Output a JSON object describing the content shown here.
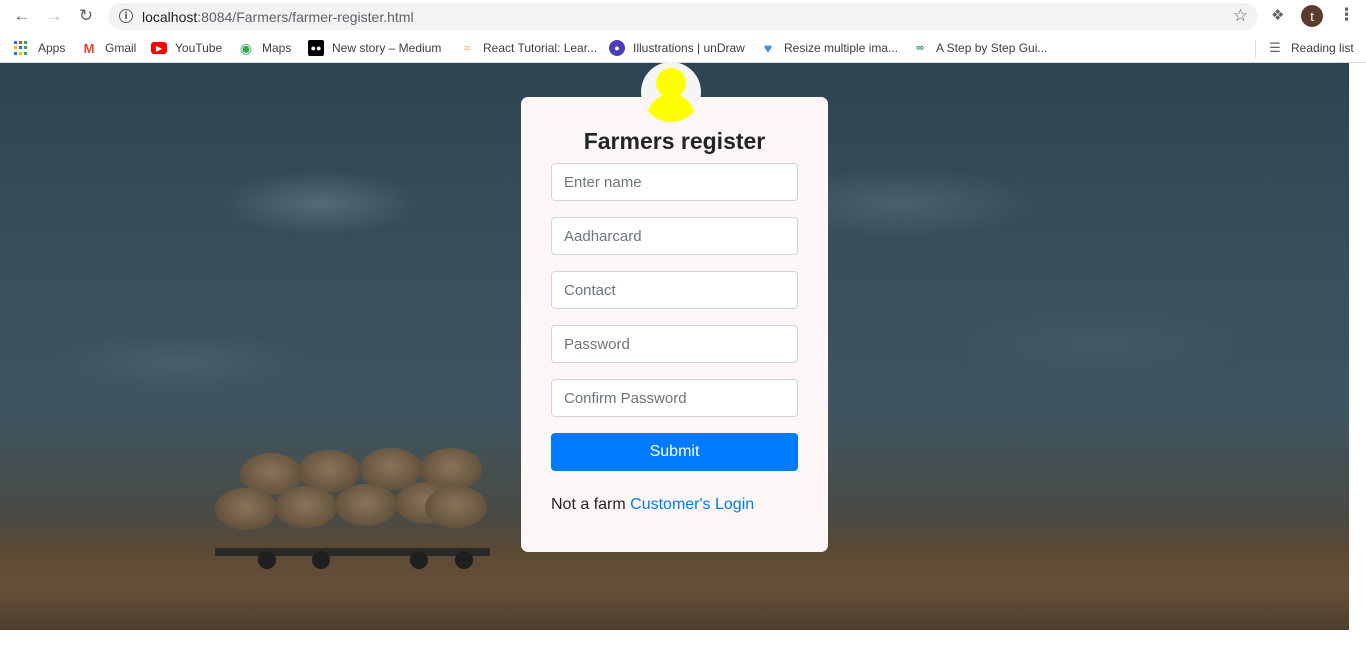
{
  "browser": {
    "url_host": "localhost",
    "url_rest": ":8084/Farmers/farmer-register.html",
    "profile_initial": "t",
    "bookmarks": [
      {
        "label": "Apps",
        "icon": "apps-grid-icon"
      },
      {
        "label": "Gmail",
        "icon": "gmail-icon"
      },
      {
        "label": "YouTube",
        "icon": "youtube-icon"
      },
      {
        "label": "Maps",
        "icon": "maps-icon"
      },
      {
        "label": "New story – Medium",
        "icon": "medium-icon"
      },
      {
        "label": "React Tutorial: Lear...",
        "icon": "react-tutorial-icon"
      },
      {
        "label": "Illustrations | unDraw",
        "icon": "undraw-icon"
      },
      {
        "label": "Resize multiple ima...",
        "icon": "resize-heart-icon"
      },
      {
        "label": "A Step by Step Gui...",
        "icon": "gfg-icon"
      }
    ],
    "reading_list": "Reading list"
  },
  "form": {
    "title": "Farmers register",
    "fields": {
      "name_placeholder": "Enter name",
      "aadhar_placeholder": "Aadharcard",
      "contact_placeholder": "Contact",
      "password_placeholder": "Password",
      "confirm_password_placeholder": "Confirm Password"
    },
    "submit_label": "Submit",
    "footer_text": "Not a farm",
    "footer_link": "Customer's Login"
  },
  "colors": {
    "primary": "#007bff",
    "avatar_icon": "#ffff00",
    "card_bg": "#fdf6f6"
  }
}
